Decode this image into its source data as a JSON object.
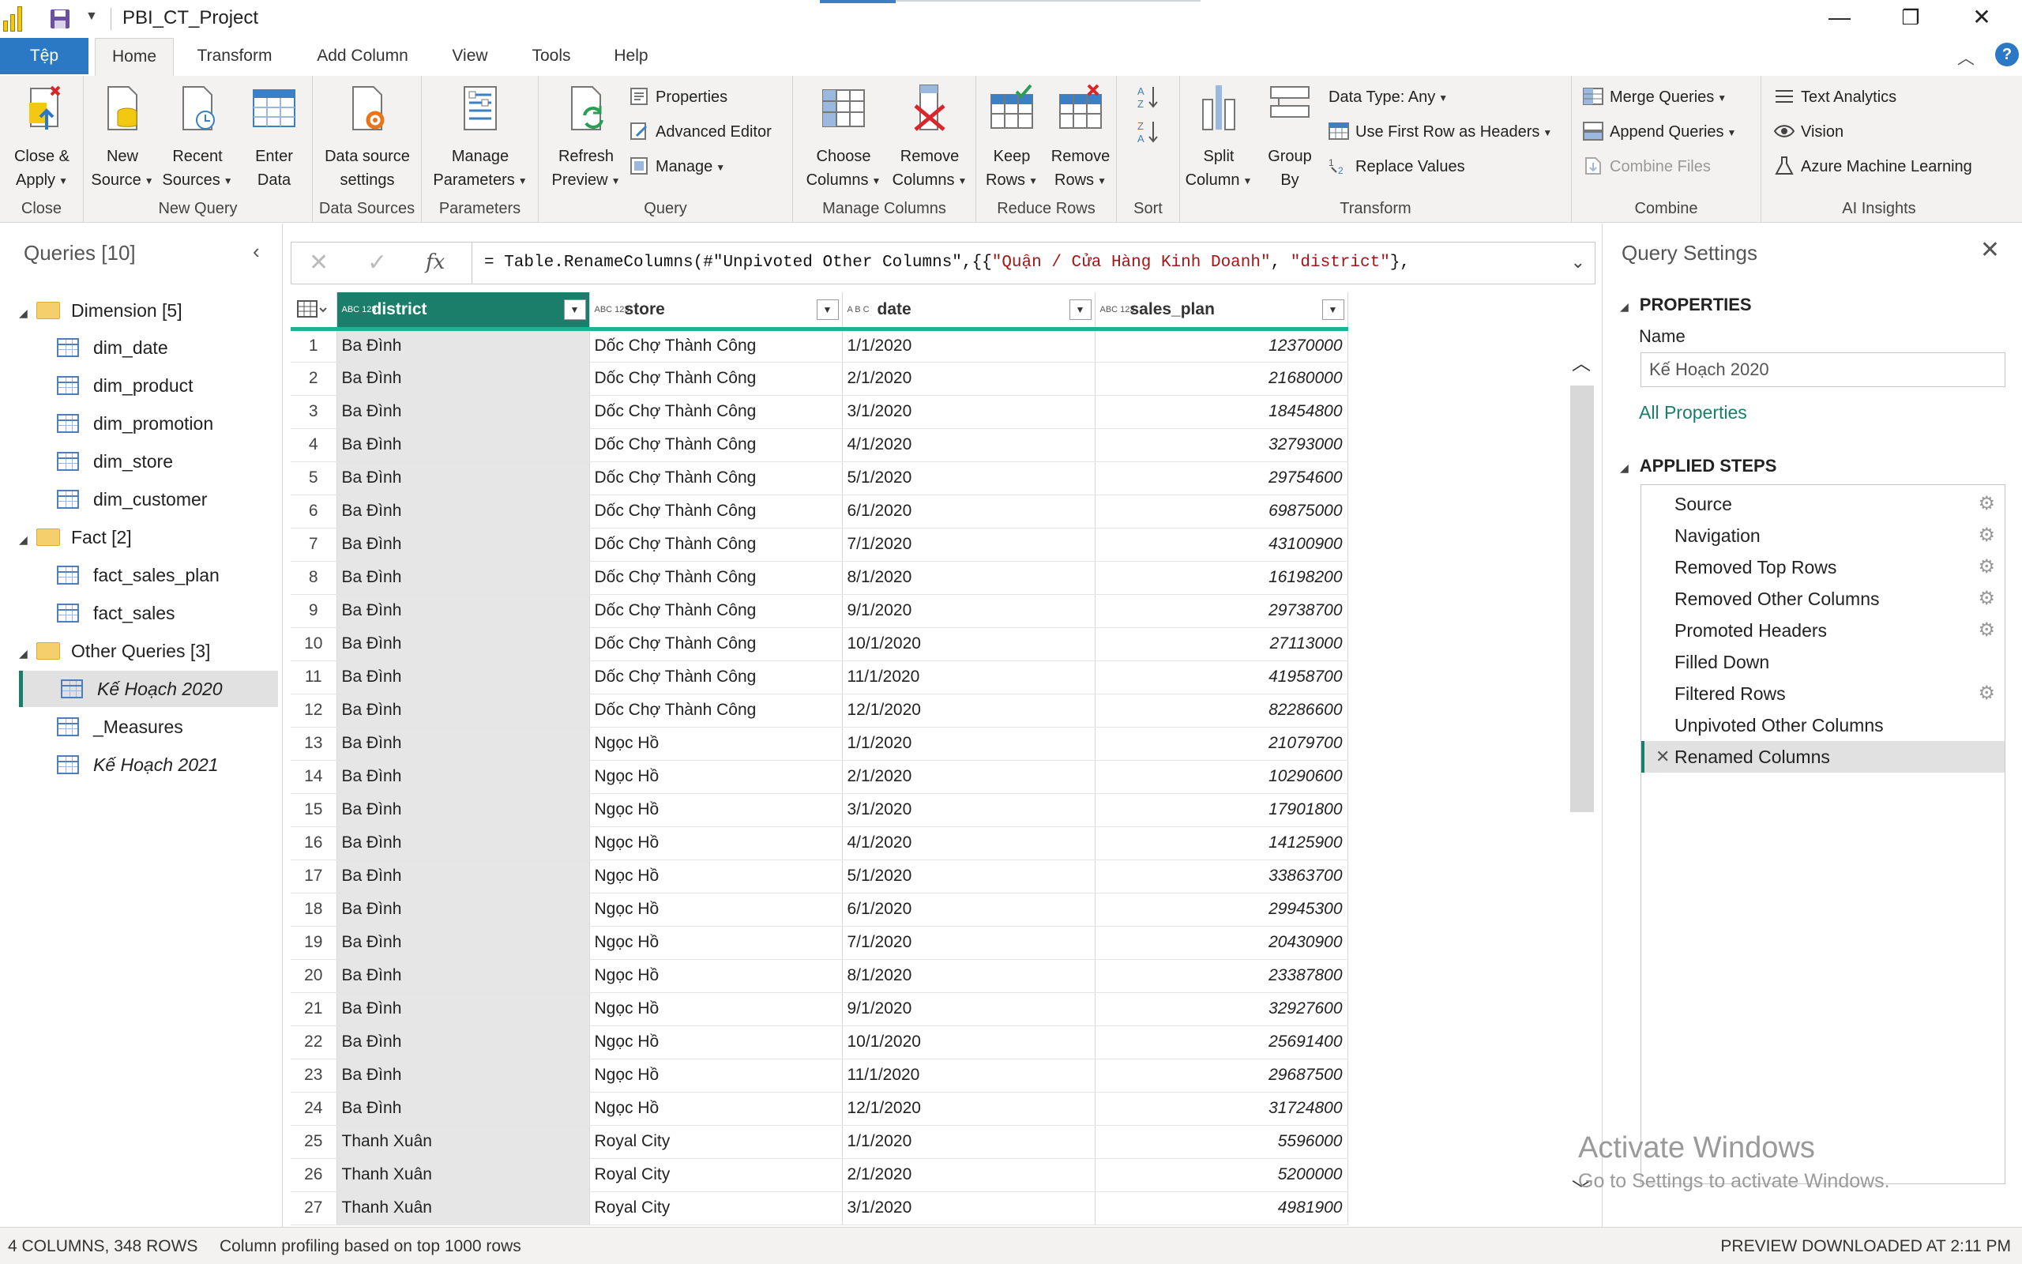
{
  "window": {
    "title": "PBI_CT_Project",
    "minimize": "—",
    "restore": "❐",
    "close": "✕"
  },
  "tabs": {
    "file": "Tệp",
    "home": "Home",
    "transform": "Transform",
    "add_column": "Add Column",
    "view": "View",
    "tools": "Tools",
    "help": "Help"
  },
  "ribbon": {
    "close_apply": [
      "Close &",
      "Apply"
    ],
    "new_source": [
      "New",
      "Source"
    ],
    "recent_sources": [
      "Recent",
      "Sources"
    ],
    "enter_data": [
      "Enter",
      "Data"
    ],
    "data_source_settings": [
      "Data source",
      "settings"
    ],
    "manage_parameters": [
      "Manage",
      "Parameters"
    ],
    "refresh_preview": [
      "Refresh",
      "Preview"
    ],
    "properties": "Properties",
    "advanced_editor": "Advanced Editor",
    "manage": "Manage",
    "choose_columns": [
      "Choose",
      "Columns"
    ],
    "remove_columns": [
      "Remove",
      "Columns"
    ],
    "keep_rows": [
      "Keep",
      "Rows"
    ],
    "remove_rows": [
      "Remove",
      "Rows"
    ],
    "split_column": [
      "Split",
      "Column"
    ],
    "group_by": [
      "Group",
      "By"
    ],
    "data_type": "Data Type: Any",
    "use_first_row": "Use First Row as Headers",
    "replace_values": "Replace Values",
    "merge_queries": "Merge Queries",
    "append_queries": "Append Queries",
    "combine_files": "Combine Files",
    "text_analytics": "Text Analytics",
    "vision": "Vision",
    "azure_ml": "Azure Machine Learning",
    "groups": {
      "close": "Close",
      "new_query": "New Query",
      "data_sources": "Data Sources",
      "parameters": "Parameters",
      "query": "Query",
      "manage_columns": "Manage Columns",
      "reduce_rows": "Reduce Rows",
      "sort": "Sort",
      "transform": "Transform",
      "combine": "Combine",
      "ai_insights": "AI Insights"
    }
  },
  "queries_panel": {
    "header": "Queries [10]",
    "items": [
      {
        "label": "Dimension [5]",
        "type": "folder"
      },
      {
        "label": "dim_date",
        "type": "table"
      },
      {
        "label": "dim_product",
        "type": "table"
      },
      {
        "label": "dim_promotion",
        "type": "table"
      },
      {
        "label": "dim_store",
        "type": "table"
      },
      {
        "label": "dim_customer",
        "type": "table"
      },
      {
        "label": "Fact [2]",
        "type": "folder"
      },
      {
        "label": "fact_sales_plan",
        "type": "table"
      },
      {
        "label": "fact_sales",
        "type": "table"
      },
      {
        "label": "Other Queries [3]",
        "type": "folder"
      },
      {
        "label": "Kế Hoạch 2020",
        "type": "table",
        "selected": true,
        "italic": true
      },
      {
        "label": "_Measures",
        "type": "table"
      },
      {
        "label": "Kế Hoạch 2021",
        "type": "table",
        "italic": true
      }
    ]
  },
  "formula": {
    "prefix": "= Table.RenameColumns(#\"Unpivoted Other Columns\",{{",
    "str1": "\"Quận / Cửa Hàng Kinh Doanh\"",
    "mid": ", ",
    "str2": "\"district\"",
    "suffix": "},"
  },
  "grid": {
    "columns": [
      {
        "name": "district",
        "type_icon": "ABC 123"
      },
      {
        "name": "store",
        "type_icon": "ABC 123"
      },
      {
        "name": "date",
        "type_icon": "A B C"
      },
      {
        "name": "sales_plan",
        "type_icon": "ABC 123"
      }
    ],
    "rows": [
      [
        "1",
        "Ba Đình",
        "Dốc Chợ Thành Công",
        "1/1/2020",
        "12370000"
      ],
      [
        "2",
        "Ba Đình",
        "Dốc Chợ Thành Công",
        "2/1/2020",
        "21680000"
      ],
      [
        "3",
        "Ba Đình",
        "Dốc Chợ Thành Công",
        "3/1/2020",
        "18454800"
      ],
      [
        "4",
        "Ba Đình",
        "Dốc Chợ Thành Công",
        "4/1/2020",
        "32793000"
      ],
      [
        "5",
        "Ba Đình",
        "Dốc Chợ Thành Công",
        "5/1/2020",
        "29754600"
      ],
      [
        "6",
        "Ba Đình",
        "Dốc Chợ Thành Công",
        "6/1/2020",
        "69875000"
      ],
      [
        "7",
        "Ba Đình",
        "Dốc Chợ Thành Công",
        "7/1/2020",
        "43100900"
      ],
      [
        "8",
        "Ba Đình",
        "Dốc Chợ Thành Công",
        "8/1/2020",
        "16198200"
      ],
      [
        "9",
        "Ba Đình",
        "Dốc Chợ Thành Công",
        "9/1/2020",
        "29738700"
      ],
      [
        "10",
        "Ba Đình",
        "Dốc Chợ Thành Công",
        "10/1/2020",
        "27113000"
      ],
      [
        "11",
        "Ba Đình",
        "Dốc Chợ Thành Công",
        "11/1/2020",
        "41958700"
      ],
      [
        "12",
        "Ba Đình",
        "Dốc Chợ Thành Công",
        "12/1/2020",
        "82286600"
      ],
      [
        "13",
        "Ba Đình",
        "Ngọc Hồ",
        "1/1/2020",
        "21079700"
      ],
      [
        "14",
        "Ba Đình",
        "Ngọc Hồ",
        "2/1/2020",
        "10290600"
      ],
      [
        "15",
        "Ba Đình",
        "Ngọc Hồ",
        "3/1/2020",
        "17901800"
      ],
      [
        "16",
        "Ba Đình",
        "Ngọc Hồ",
        "4/1/2020",
        "14125900"
      ],
      [
        "17",
        "Ba Đình",
        "Ngọc Hồ",
        "5/1/2020",
        "33863700"
      ],
      [
        "18",
        "Ba Đình",
        "Ngọc Hồ",
        "6/1/2020",
        "29945300"
      ],
      [
        "19",
        "Ba Đình",
        "Ngọc Hồ",
        "7/1/2020",
        "20430900"
      ],
      [
        "20",
        "Ba Đình",
        "Ngọc Hồ",
        "8/1/2020",
        "23387800"
      ],
      [
        "21",
        "Ba Đình",
        "Ngọc Hồ",
        "9/1/2020",
        "32927600"
      ],
      [
        "22",
        "Ba Đình",
        "Ngọc Hồ",
        "10/1/2020",
        "25691400"
      ],
      [
        "23",
        "Ba Đình",
        "Ngọc Hồ",
        "11/1/2020",
        "29687500"
      ],
      [
        "24",
        "Ba Đình",
        "Ngọc Hồ",
        "12/1/2020",
        "31724800"
      ],
      [
        "25",
        "Thanh Xuân",
        "Royal City",
        "1/1/2020",
        "5596000"
      ],
      [
        "26",
        "Thanh Xuân",
        "Royal City",
        "2/1/2020",
        "5200000"
      ],
      [
        "27",
        "Thanh Xuân",
        "Royal City",
        "3/1/2020",
        "4981900"
      ]
    ]
  },
  "settings": {
    "header": "Query Settings",
    "properties": "PROPERTIES",
    "name_label": "Name",
    "name_value": "Kế Hoạch 2020",
    "all_properties": "All Properties",
    "applied_steps": "APPLIED STEPS",
    "steps": [
      {
        "label": "Source",
        "gear": true
      },
      {
        "label": "Navigation",
        "gear": true
      },
      {
        "label": "Removed Top Rows",
        "gear": true
      },
      {
        "label": "Removed Other Columns",
        "gear": true
      },
      {
        "label": "Promoted Headers",
        "gear": true
      },
      {
        "label": "Filled Down",
        "gear": false
      },
      {
        "label": "Filtered Rows",
        "gear": true
      },
      {
        "label": "Unpivoted Other Columns",
        "gear": false
      },
      {
        "label": "Renamed Columns",
        "gear": false,
        "current": true
      }
    ]
  },
  "watermark": {
    "line1": "Activate Windows",
    "line2": "Go to Settings to activate Windows."
  },
  "status": {
    "columns_rows": "4 COLUMNS, 348 ROWS",
    "profiling": "Column profiling based on top 1000 rows",
    "preview": "PREVIEW DOWNLOADED AT 2:11 PM"
  },
  "colors": {
    "accent": "#1a7e6a",
    "file_tab": "#2b78c5",
    "header_underline": "#1ab394"
  }
}
